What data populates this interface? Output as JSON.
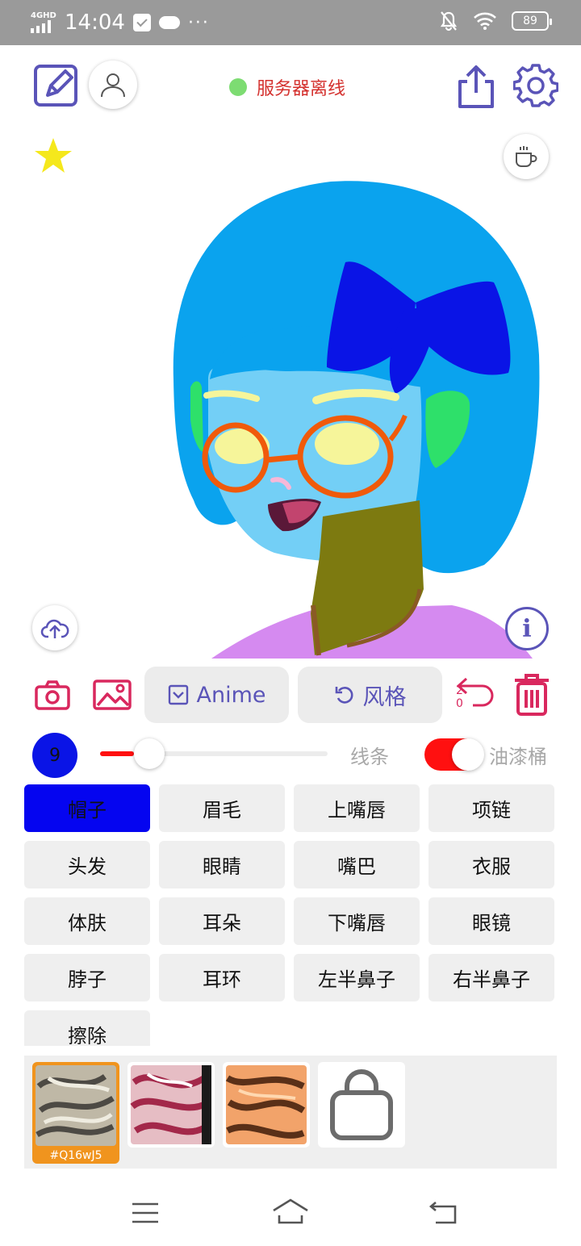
{
  "status_bar": {
    "network": "4GHD",
    "time": "14:04",
    "more": "···",
    "battery": "89"
  },
  "toolbar": {
    "server_status": "服务器离线",
    "server_status_color": "#7ddc72",
    "accent_color": "#5a54b8"
  },
  "canvas": {
    "description_icon_hair": "blue-bob-hair",
    "info_label": "i"
  },
  "tools": {
    "anime_label": "Anime",
    "style_label": "风格",
    "undo_count_top": "2",
    "undo_count_bottom": "0"
  },
  "brush": {
    "size": "9",
    "size_level": 0.1,
    "line_label": "线条",
    "bucket_label": "油漆桶",
    "bucket_enabled": true,
    "brush_color": "#0a14e6"
  },
  "parts": [
    {
      "label": "帽子",
      "active": true
    },
    {
      "label": "眉毛"
    },
    {
      "label": "上嘴唇"
    },
    {
      "label": "项链"
    },
    {
      "label": "头发"
    },
    {
      "label": "眼睛"
    },
    {
      "label": "嘴巴"
    },
    {
      "label": "衣服"
    },
    {
      "label": "体肤"
    },
    {
      "label": "耳朵"
    },
    {
      "label": "下嘴唇"
    },
    {
      "label": "眼镜"
    },
    {
      "label": "脖子"
    },
    {
      "label": "耳环"
    },
    {
      "label": "左半鼻子"
    },
    {
      "label": "右半鼻子"
    },
    {
      "label": "擦除"
    }
  ],
  "styles": {
    "selected_code": "#Q16wJ5",
    "items": [
      "style-gray-swirl",
      "style-pink-swirl",
      "style-orange-swirl",
      "shop-bag"
    ]
  }
}
